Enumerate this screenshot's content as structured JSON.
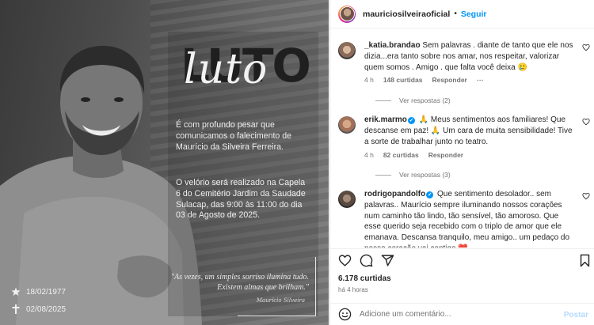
{
  "post_image": {
    "headline_block": "LUTO",
    "headline_script": "luto",
    "paragraph_1": "É com profundo pesar que comunicamos o falecimento de Maurício da Silveira Ferreira.",
    "paragraph_2": "O velório será realizado na Capela 6 do Cemitério Jardim da Saudade Sulacap, das 9:00 às 11:00 do dia 03 de Agosto de 2025.",
    "quote": "\"As vezes, um simples sorriso ilumina tudo. Existem almas que brilham.\"",
    "signature": "Maurício Silveira",
    "birth_date": "18/02/1977",
    "death_date": "02/08/2025",
    "birth_icon": "star-icon",
    "death_icon": "cross-icon"
  },
  "header": {
    "username": "mauriciosilveiraoficial",
    "separator": "•",
    "follow_label": "Seguir"
  },
  "comments": [
    {
      "username": "_katia.brandao",
      "verified": false,
      "text": "Sem palavras . diante de tanto que ele nos dizia...era tanto sobre nos amar, nos respeitar, valorizar quem somos . Amigo . que falta você deixa 🥲",
      "time": "4 h",
      "likes": "148 curtidas",
      "reply_label": "Responder",
      "more_label": "⋯",
      "view_replies": "Ver respostas (2)"
    },
    {
      "username": "erik.marmo",
      "verified": true,
      "text": "🙏 Meus sentimentos aos familiares! Que descanse em paz! 🙏 Um cara de muita sensibilidade! Tive a sorte de trabalhar junto no teatro.",
      "time": "4 h",
      "likes": "82 curtidas",
      "reply_label": "Responder",
      "view_replies": "Ver respostas (3)"
    },
    {
      "username": "rodrigopandolfo",
      "verified": true,
      "text": "Que sentimento desolador.. sem palavras.. Maurício sempre iluminando nossos corações num caminho tão lindo, tão sensível, tão amoroso. Que esse querido seja recebido com o triplo de amor que ele emanava. Descansa tranquilo, meu amigo.. um pedaço do nosso coração vai contigo ❤️"
    }
  ],
  "actions": {
    "like_icon": "heart-icon",
    "comment_icon": "comment-icon",
    "share_icon": "send-icon",
    "save_icon": "bookmark-icon"
  },
  "likes_count": "6.178 curtidas",
  "time_ago": "há 4 horas",
  "add_comment": {
    "placeholder": "Adicione um comentário...",
    "post_label": "Postar",
    "emoji_icon": "emoji-icon"
  }
}
